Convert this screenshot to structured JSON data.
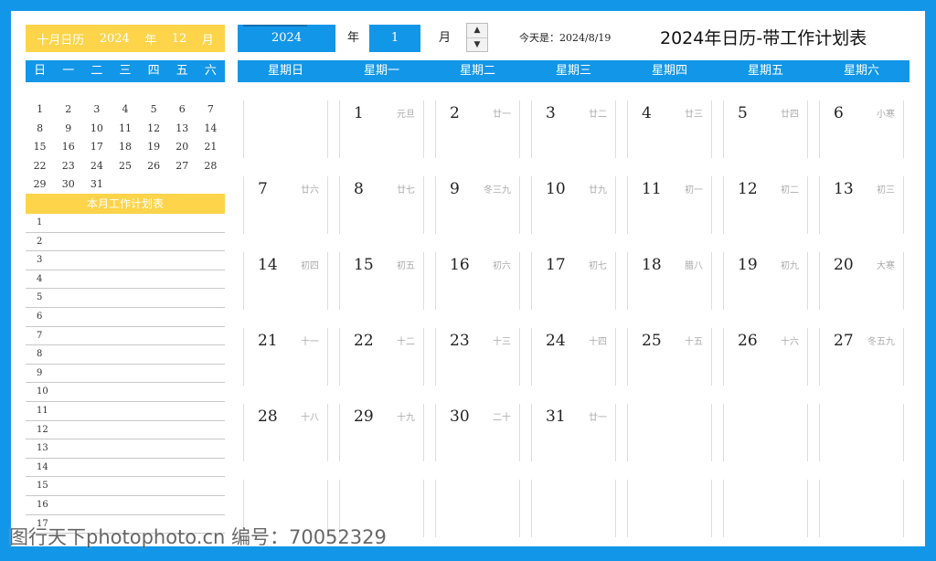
{
  "colors": {
    "accent": "#1296e8",
    "yellow": "#fdd44a"
  },
  "mini": {
    "header": [
      "十月日历",
      "2024",
      "年",
      "12",
      "月"
    ],
    "weekdays": [
      "日",
      "一",
      "二",
      "三",
      "四",
      "五",
      "六"
    ],
    "rows": [
      [
        "1",
        "2",
        "3",
        "4",
        "5",
        "6",
        "7"
      ],
      [
        "8",
        "9",
        "10",
        "11",
        "12",
        "13",
        "14"
      ],
      [
        "15",
        "16",
        "17",
        "18",
        "19",
        "20",
        "21"
      ],
      [
        "22",
        "23",
        "24",
        "25",
        "26",
        "27",
        "28"
      ],
      [
        "29",
        "30",
        "31",
        "",
        "",
        "",
        ""
      ]
    ]
  },
  "plan": {
    "title": "本月工作计划表",
    "rows": [
      "1",
      "2",
      "3",
      "4",
      "5",
      "6",
      "7",
      "8",
      "9",
      "10",
      "11",
      "12",
      "13",
      "14",
      "15",
      "16",
      "17"
    ]
  },
  "controls": {
    "year": "2024",
    "year_label": "年",
    "month": "1",
    "month_label": "月",
    "spinner_up": "▲",
    "spinner_down": "▼",
    "today": "今天是：2024/8/19"
  },
  "title": "2024年日历-带工作计划表",
  "week_header": [
    "星期日",
    "星期一",
    "星期二",
    "星期三",
    "星期四",
    "星期五",
    "星期六"
  ],
  "calendar": [
    [
      {
        "d": "",
        "l": ""
      },
      {
        "d": "1",
        "l": "元旦"
      },
      {
        "d": "2",
        "l": "廿一"
      },
      {
        "d": "3",
        "l": "廿二"
      },
      {
        "d": "4",
        "l": "廿三"
      },
      {
        "d": "5",
        "l": "廿四"
      },
      {
        "d": "6",
        "l": "小寒"
      }
    ],
    [
      {
        "d": "7",
        "l": "廿六"
      },
      {
        "d": "8",
        "l": "廿七"
      },
      {
        "d": "9",
        "l": "冬三九"
      },
      {
        "d": "10",
        "l": "廿九"
      },
      {
        "d": "11",
        "l": "初一"
      },
      {
        "d": "12",
        "l": "初二"
      },
      {
        "d": "13",
        "l": "初三"
      }
    ],
    [
      {
        "d": "14",
        "l": "初四"
      },
      {
        "d": "15",
        "l": "初五"
      },
      {
        "d": "16",
        "l": "初六"
      },
      {
        "d": "17",
        "l": "初七"
      },
      {
        "d": "18",
        "l": "腊八"
      },
      {
        "d": "19",
        "l": "初九"
      },
      {
        "d": "20",
        "l": "大寒"
      }
    ],
    [
      {
        "d": "21",
        "l": "十一"
      },
      {
        "d": "22",
        "l": "十二"
      },
      {
        "d": "23",
        "l": "十三"
      },
      {
        "d": "24",
        "l": "十四"
      },
      {
        "d": "25",
        "l": "十五"
      },
      {
        "d": "26",
        "l": "十六"
      },
      {
        "d": "27",
        "l": "冬五九"
      }
    ],
    [
      {
        "d": "28",
        "l": "十八"
      },
      {
        "d": "29",
        "l": "十九"
      },
      {
        "d": "30",
        "l": "二十"
      },
      {
        "d": "31",
        "l": "廿一"
      },
      {
        "d": "",
        "l": ""
      },
      {
        "d": "",
        "l": ""
      },
      {
        "d": "",
        "l": ""
      }
    ],
    [
      {
        "d": "",
        "l": ""
      },
      {
        "d": "",
        "l": ""
      },
      {
        "d": "",
        "l": ""
      },
      {
        "d": "",
        "l": ""
      },
      {
        "d": "",
        "l": ""
      },
      {
        "d": "",
        "l": ""
      },
      {
        "d": "",
        "l": ""
      }
    ]
  ],
  "watermark": "图行天下photophoto.cn  编号：70052329"
}
